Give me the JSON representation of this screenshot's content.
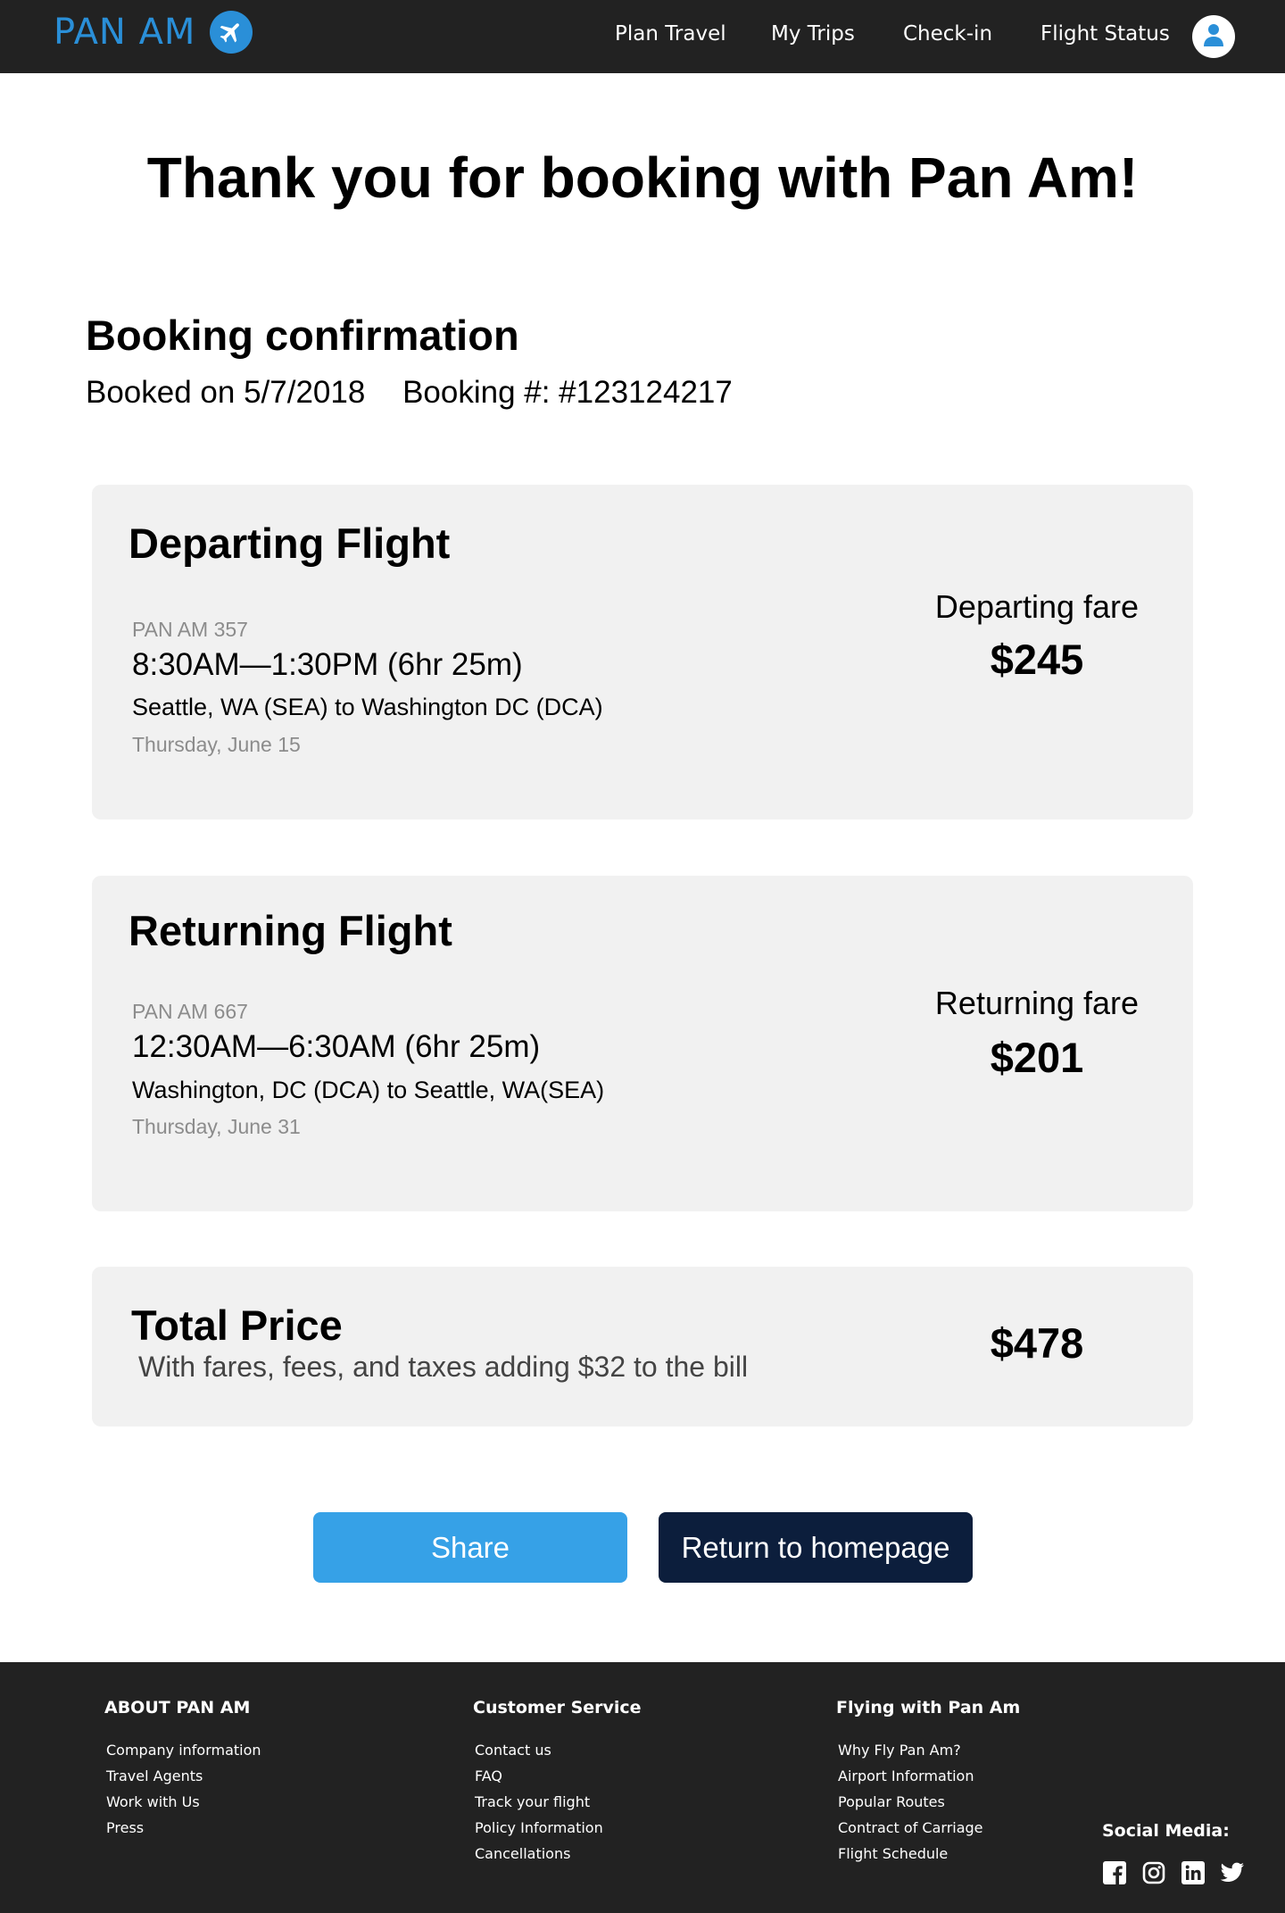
{
  "brand": {
    "name": "PAN AM",
    "accent": "#2a8fd8",
    "icon": "airplane-icon"
  },
  "nav": {
    "items": [
      {
        "label": "Plan Travel"
      },
      {
        "label": "My Trips"
      },
      {
        "label": "Check-in"
      },
      {
        "label": "Flight Status"
      }
    ],
    "avatar_icon": "user-icon"
  },
  "page_title": "Thank you for booking with Pan Am!",
  "confirmation": {
    "title": "Booking confirmation",
    "booked_on": "Booked on 5/7/2018",
    "booking_number": "Booking #: #123124217"
  },
  "departing": {
    "title": "Departing Flight",
    "flight_code": "PAN AM 357",
    "times": "8:30AM—1:30PM (6hr 25m)",
    "route": "Seattle, WA (SEA) to Washington DC (DCA)",
    "date": "Thursday, June 15",
    "fare_label": "Departing fare",
    "fare": "$245"
  },
  "returning": {
    "title": "Returning Flight",
    "flight_code": "PAN AM 667",
    "times": "12:30AM—6:30AM (6hr 25m)",
    "route": "Washington, DC (DCA) to Seattle, WA(SEA)",
    "date": "Thursday, June 31",
    "fare_label": "Returning fare",
    "fare": "$201"
  },
  "total": {
    "title": "Total Price",
    "note": "With fares, fees, and taxes adding $32 to the bill",
    "amount": "$478"
  },
  "buttons": {
    "share": "Share",
    "share_color": "#36a1e7",
    "home": "Return to homepage",
    "home_color": "#0c1e3c"
  },
  "footer": {
    "columns": [
      {
        "heading": "ABOUT PAN AM",
        "links": [
          "Company information",
          "Travel Agents",
          "Work with Us",
          "Press"
        ]
      },
      {
        "heading": "Customer Service",
        "links": [
          "Contact us",
          "FAQ",
          "Track your flight",
          "Policy Information",
          "Cancellations"
        ]
      },
      {
        "heading": "Flying with Pan Am",
        "links": [
          "Why Fly Pan Am?",
          "Airport Information",
          "Popular Routes",
          "Contract of Carriage",
          "Flight Schedule"
        ]
      }
    ],
    "social_heading": "Social Media:",
    "social_icons": [
      "facebook-icon",
      "instagram-icon",
      "linkedin-icon",
      "twitter-icon"
    ]
  }
}
